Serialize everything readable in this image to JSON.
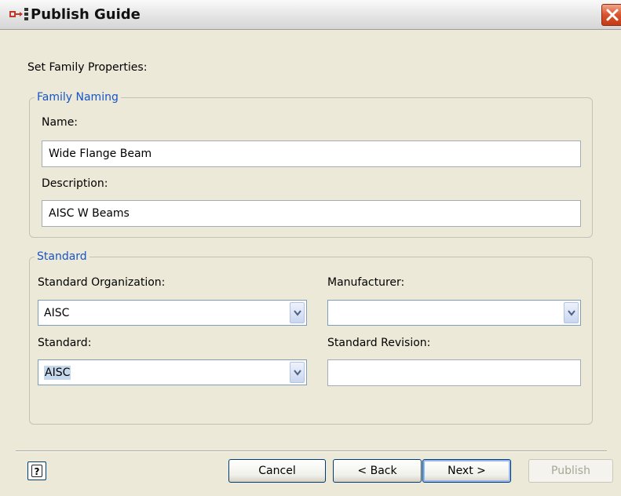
{
  "window": {
    "title": "Publish Guide",
    "app_icon": "publish-guide-icon",
    "close_icon": "close-icon"
  },
  "intro_label": "Set Family Properties:",
  "family_naming": {
    "legend": "Family Naming",
    "name_label": "Name:",
    "name_value": "Wide Flange Beam",
    "description_label": "Description:",
    "description_value": "AISC W Beams"
  },
  "standard": {
    "legend": "Standard",
    "organization_label": "Standard Organization:",
    "organization_value": "AISC",
    "manufacturer_label": "Manufacturer:",
    "manufacturer_value": "",
    "standard_label": "Standard:",
    "standard_value": "AISC",
    "revision_label": "Standard Revision:",
    "revision_value": ""
  },
  "footer": {
    "help_icon": "help-icon",
    "help_glyph": "?",
    "cancel_label": "Cancel",
    "back_label": "< Back",
    "next_label": "Next >",
    "publish_label": "Publish"
  },
  "colors": {
    "dialog_bg": "#ECE9D8",
    "legend_text": "#1654c9",
    "close_button": "#d9532c"
  }
}
